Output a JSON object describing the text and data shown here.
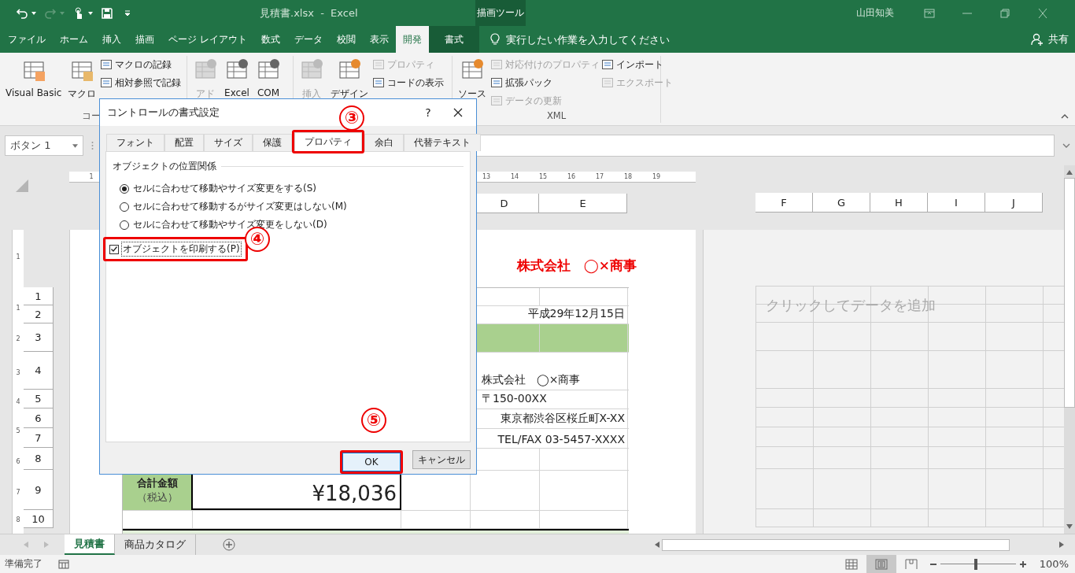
{
  "title_bar": {
    "document": "見積書.xlsx  -  Excel",
    "context_group": "描画ツール",
    "user": "山田知美"
  },
  "tabs": [
    {
      "label": "ファイル",
      "selected": false,
      "kind": "normal"
    },
    {
      "label": "ホーム",
      "selected": false,
      "kind": "normal"
    },
    {
      "label": "挿入",
      "selected": false,
      "kind": "normal"
    },
    {
      "label": "描画",
      "selected": false,
      "kind": "normal"
    },
    {
      "label": "ページ レイアウト",
      "selected": false,
      "kind": "normal"
    },
    {
      "label": "数式",
      "selected": false,
      "kind": "normal"
    },
    {
      "label": "データ",
      "selected": false,
      "kind": "normal"
    },
    {
      "label": "校閲",
      "selected": false,
      "kind": "normal"
    },
    {
      "label": "表示",
      "selected": false,
      "kind": "normal"
    },
    {
      "label": "開発",
      "selected": true,
      "kind": "normal"
    },
    {
      "label": "書式",
      "selected": false,
      "kind": "context"
    }
  ],
  "tell_me": {
    "placeholder": "実行したい作業を入力してください"
  },
  "share": "共有",
  "ribbon": {
    "groups": [
      {
        "label": "コー",
        "items": [
          {
            "kind": "large",
            "label": "Visual Basic",
            "disabled": false
          },
          {
            "kind": "large",
            "label": "マクロ",
            "disabled": false
          },
          {
            "kind": "small",
            "label": "マクロの記録",
            "disabled": false
          },
          {
            "kind": "small",
            "label": "相対参照で記録",
            "disabled": false
          }
        ]
      },
      {
        "items": [
          {
            "kind": "large",
            "label": "アド",
            "disabled": true
          },
          {
            "kind": "large",
            "label": "Excel",
            "disabled": false
          },
          {
            "kind": "large",
            "label": "COM",
            "disabled": false
          }
        ]
      },
      {
        "items": [
          {
            "kind": "large",
            "label": "挿入",
            "disabled": true
          },
          {
            "kind": "large",
            "label": "デザイン",
            "disabled": false
          },
          {
            "kind": "small",
            "label": "プロパティ",
            "disabled": true
          },
          {
            "kind": "small",
            "label": "コードの表示",
            "disabled": false
          }
        ]
      },
      {
        "label": "XML",
        "items": [
          {
            "kind": "large",
            "label": "ソース",
            "disabled": false
          },
          {
            "kind": "small",
            "label": "対応付けのプロパティ",
            "disabled": true
          },
          {
            "kind": "small",
            "label": "拡張パック",
            "disabled": false
          },
          {
            "kind": "small",
            "label": "データの更新",
            "disabled": true
          },
          {
            "kind": "small2",
            "label": "インポート",
            "disabled": false
          },
          {
            "kind": "small2",
            "label": "エクスポート",
            "disabled": true
          }
        ]
      }
    ]
  },
  "name_box": "ボタン 1",
  "sheet": {
    "ruler_numbers": [
      "1",
      "13",
      "14",
      "15",
      "16",
      "17",
      "18",
      "19"
    ],
    "vertical_ruler": [
      "1",
      "1",
      "2",
      "3",
      "4",
      "5",
      "6",
      "7",
      "8"
    ],
    "columns": [
      "D",
      "E"
    ],
    "page2_columns": [
      "F",
      "G",
      "H",
      "I",
      "J"
    ],
    "title": "株式会社　◯×商事",
    "rows": [
      {
        "header": "1",
        "kind": "plain",
        "cells": []
      },
      {
        "header": "2",
        "kind": "plain",
        "cells": [
          {
            "kind": "de-right",
            "text": "平成29年12月15日"
          }
        ]
      },
      {
        "header": "3",
        "kind": "band",
        "cells": []
      },
      {
        "header": "4",
        "kind": "plain",
        "cells": [
          {
            "kind": "de-left",
            "text": "株式会社　◯×商事"
          }
        ]
      },
      {
        "header": "5",
        "kind": "plain",
        "cells": [
          {
            "kind": "de-left",
            "text": "〒150-00XX"
          }
        ]
      },
      {
        "header": "6",
        "kind": "plain",
        "cells": [
          {
            "kind": "de-right",
            "text": "東京都渋谷区桜丘町X-XX"
          }
        ]
      },
      {
        "header": "7",
        "kind": "plain",
        "cells": [
          {
            "kind": "de-right",
            "text": "TEL/FAX 03-5457-XXXX"
          }
        ]
      },
      {
        "header": "8",
        "kind": "plain",
        "cells": []
      },
      {
        "header": "9",
        "kind": "plain",
        "cells": [
          {
            "kind": "a-label",
            "text": "合計金額",
            "note": "（税込）"
          },
          {
            "kind": "b-value",
            "text": "¥18,036"
          }
        ]
      },
      {
        "header": "10",
        "kind": "plain",
        "cells": []
      }
    ],
    "page2_placeholder": "クリックしてデータを追加"
  },
  "dialog": {
    "title": "コントロールの書式設定",
    "help": "?",
    "tabs": [
      {
        "label": "フォント",
        "selected": false
      },
      {
        "label": "配置",
        "selected": false
      },
      {
        "label": "サイズ",
        "selected": false
      },
      {
        "label": "保護",
        "selected": false
      },
      {
        "label": "プロパティ",
        "selected": true,
        "highlighted": true
      },
      {
        "label": "余白",
        "selected": false
      },
      {
        "label": "代替テキスト",
        "selected": false
      }
    ],
    "section": "オブジェクトの位置関係",
    "radios": [
      {
        "label": "セルに合わせて移動やサイズ変更をする(S)",
        "selected": true
      },
      {
        "label": "セルに合わせて移動するがサイズ変更はしない(M)",
        "selected": false
      },
      {
        "label": "セルに合わせて移動やサイズ変更をしない(D)",
        "selected": false
      }
    ],
    "print_checkbox": {
      "label": "オブジェクトを印刷する(P)",
      "checked": true,
      "highlighted": true
    },
    "buttons": [
      {
        "label": "OK",
        "kind": "default",
        "highlighted": true
      },
      {
        "label": "キャンセル",
        "kind": "normal"
      }
    ]
  },
  "annotations": [
    {
      "label": "③"
    },
    {
      "label": "④"
    },
    {
      "label": "⑤"
    }
  ],
  "sheet_tabs": [
    {
      "label": "見積書",
      "selected": true
    },
    {
      "label": "商品カタログ",
      "selected": false
    }
  ],
  "status": {
    "text": "準備完了",
    "views": [
      {
        "kind": "normal",
        "selected": false
      },
      {
        "kind": "page-layout",
        "selected": true
      },
      {
        "kind": "page-break",
        "selected": false
      }
    ],
    "zoom": {
      "level": 0.45,
      "reading": "100%"
    }
  }
}
